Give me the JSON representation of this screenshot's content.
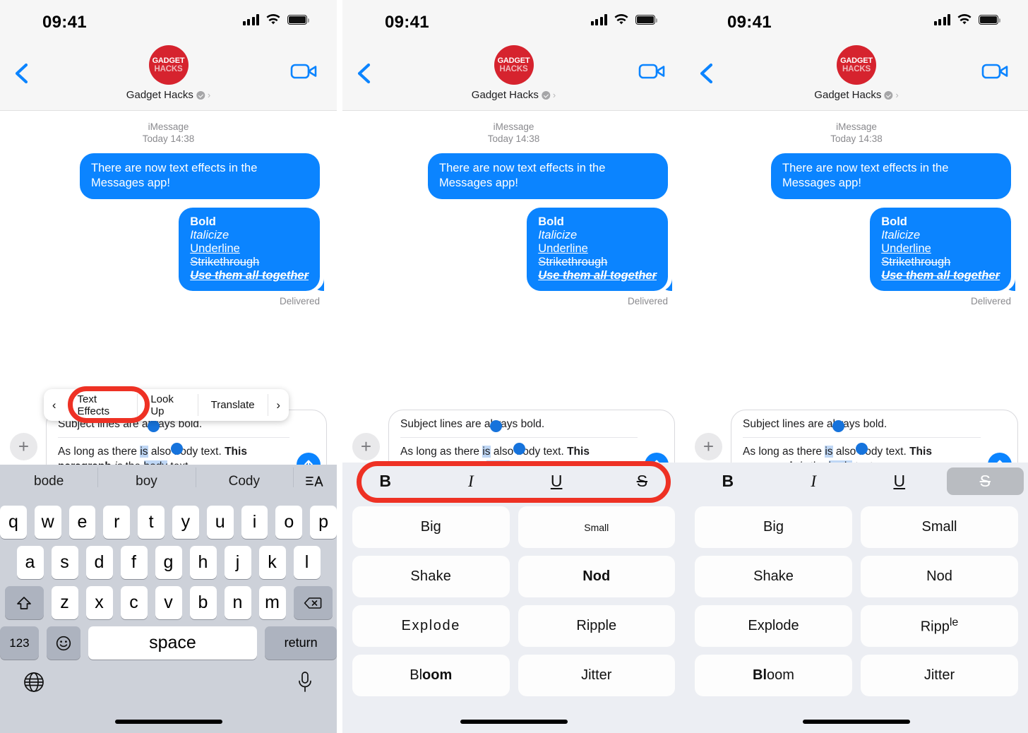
{
  "status_bar": {
    "time": "09:41",
    "signal_icon": "cellular-bars-icon",
    "wifi_icon": "wifi-icon",
    "battery_icon": "battery-icon"
  },
  "nav": {
    "back_icon": "chevron-left-icon",
    "video_icon": "facetime-video-icon",
    "contact_name": "Gadget Hacks",
    "verified_icon": "verified-check-icon",
    "disclosure_icon": "chevron-right-icon",
    "avatar": {
      "line1": "GADGET",
      "line2": "HACKS",
      "color": "#d6232e"
    }
  },
  "conversation": {
    "service": "iMessage",
    "timestamp": "Today 14:38",
    "delivered_label": "Delivered",
    "bubbles": [
      {
        "text": "There are now text effects in the Messages app!"
      },
      {
        "lines": [
          "Bold",
          "Italicize",
          "Underline",
          "Strikethrough",
          "Use them all together"
        ]
      }
    ],
    "bubble_color": "#0b84ff"
  },
  "compose": {
    "plus_icon": "plus-icon",
    "send_icon": "send-arrow-up-icon",
    "subject": "Subject lines are always bold.",
    "body": {
      "part1": "As long as there ",
      "selected": "is",
      "part2": " also body text. ",
      "bold": "This paragraph",
      "italic": " is ",
      "underline": "the",
      "sel_word": "body",
      "part3": " text."
    }
  },
  "context_menu": {
    "prev_icon": "chevron-left-icon",
    "next_icon": "chevron-right-icon",
    "items": [
      "Text Effects",
      "Look Up",
      "Translate"
    ],
    "highlight_color": "#ee3124"
  },
  "keyboard": {
    "suggestions": [
      "bode",
      "boy",
      "Cody"
    ],
    "format_icon": "text-format-icon",
    "row1": [
      "q",
      "w",
      "e",
      "r",
      "t",
      "y",
      "u",
      "i",
      "o",
      "p"
    ],
    "row2": [
      "a",
      "s",
      "d",
      "f",
      "g",
      "h",
      "j",
      "k",
      "l"
    ],
    "row3": [
      "z",
      "x",
      "c",
      "v",
      "b",
      "n",
      "m"
    ],
    "shift_icon": "shift-arrow-icon",
    "backspace_icon": "backspace-delete-icon",
    "numbers_label": "123",
    "emoji_icon": "emoji-smiley-icon",
    "space_label": "space",
    "return_label": "return",
    "globe_icon": "globe-language-icon",
    "mic_icon": "microphone-icon"
  },
  "format_toolbar": {
    "bold_label": "B",
    "italic_label": "I",
    "underline_label": "U",
    "strikethrough_label": "S",
    "active_in_panel3": "S"
  },
  "text_effects": {
    "items": [
      "Big",
      "Small",
      "Shake",
      "Nod",
      "Explode",
      "Ripple",
      "Bloom",
      "Jitter"
    ],
    "ripple_main": "Ripp",
    "ripple_sup": "le",
    "bloom_bold": "Bl",
    "bloom_rest": "oom"
  },
  "panels": [
    {
      "id": "panel-1",
      "state": "context-menu-with-text-effects-highlighted"
    },
    {
      "id": "panel-2",
      "state": "format-toolbar-highlighted"
    },
    {
      "id": "panel-3",
      "state": "strikethrough-applied"
    }
  ]
}
